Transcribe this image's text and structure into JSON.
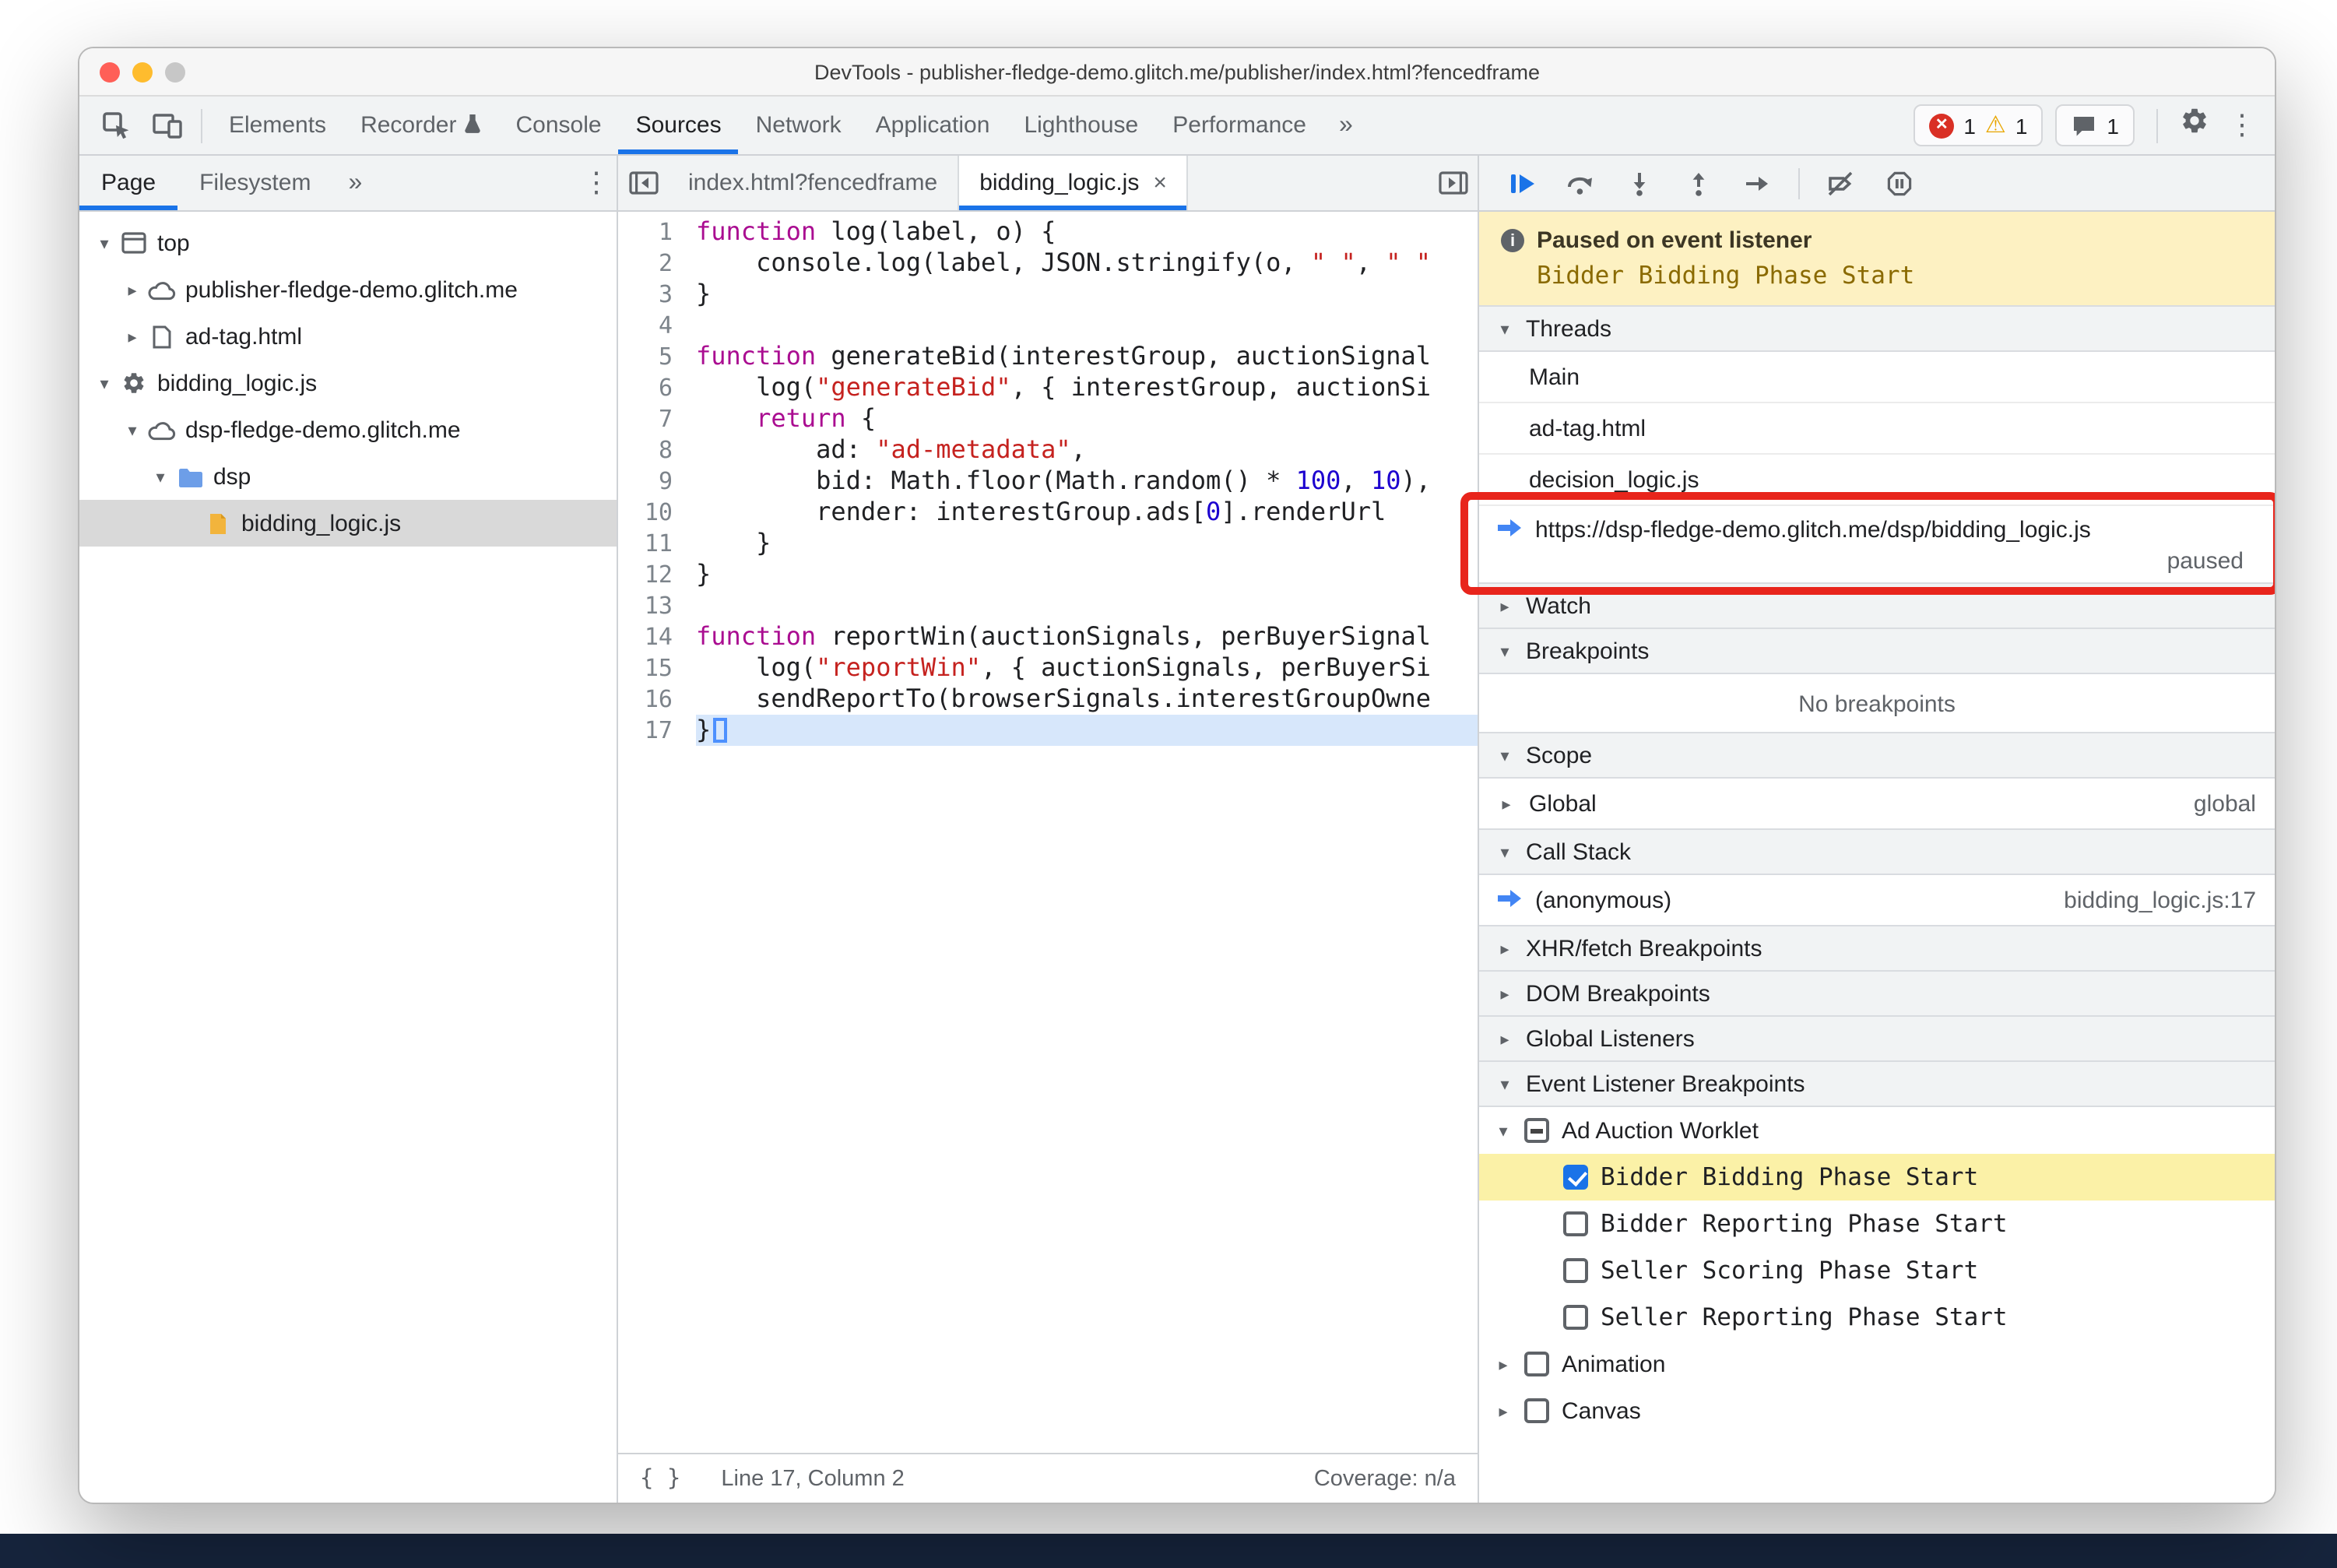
{
  "window": {
    "title": "DevTools - publisher-fledge-demo.glitch.me/publisher/index.html?fencedframe"
  },
  "toolbar": {
    "tabs": [
      {
        "label": "Elements"
      },
      {
        "label": "Recorder",
        "icon": "experiment-icon"
      },
      {
        "label": "Console"
      },
      {
        "label": "Sources",
        "active": true
      },
      {
        "label": "Network"
      },
      {
        "label": "Application"
      },
      {
        "label": "Lighthouse"
      },
      {
        "label": "Performance"
      }
    ],
    "more_label": "»",
    "errors": "1",
    "warnings": "1",
    "issues": "1"
  },
  "navigator": {
    "tabs": [
      {
        "label": "Page",
        "active": true
      },
      {
        "label": "Filesystem"
      }
    ],
    "more_label": "»",
    "tree": [
      {
        "label": "top",
        "icon": "frame",
        "state": "expanded",
        "indent": 0
      },
      {
        "label": "publisher-fledge-demo.glitch.me",
        "icon": "cloud",
        "state": "collapsed",
        "indent": 1
      },
      {
        "label": "ad-tag.html",
        "icon": "doc",
        "state": "collapsed",
        "indent": 1
      },
      {
        "label": "bidding_logic.js",
        "icon": "gear",
        "state": "expanded",
        "indent": 0
      },
      {
        "label": "dsp-fledge-demo.glitch.me",
        "icon": "cloud",
        "state": "expanded",
        "indent": 1
      },
      {
        "label": "dsp",
        "icon": "folder",
        "state": "expanded",
        "indent": 2
      },
      {
        "label": "bidding_logic.js",
        "icon": "file",
        "state": "leaf",
        "indent": 3,
        "selected": true
      }
    ]
  },
  "editor": {
    "tabs": [
      {
        "label": "index.html?fencedframe"
      },
      {
        "label": "bidding_logic.js",
        "active": true
      }
    ],
    "exec_line": 17,
    "lines": [
      {
        "n": 1,
        "seg": [
          [
            "k",
            "function"
          ],
          [
            "p",
            " log(label, o) {"
          ]
        ]
      },
      {
        "n": 2,
        "seg": [
          [
            "p",
            "    console.log(label, JSON.stringify(o, "
          ],
          [
            "s",
            "\" \""
          ],
          [
            "p",
            ", "
          ],
          [
            "s",
            "\" \""
          ]
        ]
      },
      {
        "n": 3,
        "seg": [
          [
            "p",
            "}"
          ]
        ]
      },
      {
        "n": 4,
        "seg": []
      },
      {
        "n": 5,
        "seg": [
          [
            "k",
            "function"
          ],
          [
            "p",
            " generateBid(interestGroup, auctionSignal"
          ]
        ]
      },
      {
        "n": 6,
        "seg": [
          [
            "p",
            "    log("
          ],
          [
            "s",
            "\"generateBid\""
          ],
          [
            "p",
            ", { interestGroup, auctionSi"
          ]
        ]
      },
      {
        "n": 7,
        "seg": [
          [
            "p",
            "    "
          ],
          [
            "k",
            "return"
          ],
          [
            "p",
            " {"
          ]
        ]
      },
      {
        "n": 8,
        "seg": [
          [
            "p",
            "        ad: "
          ],
          [
            "s",
            "\"ad-metadata\""
          ],
          [
            "p",
            ","
          ]
        ]
      },
      {
        "n": 9,
        "seg": [
          [
            "p",
            "        bid: Math.floor(Math.random() * "
          ],
          [
            "num",
            "100"
          ],
          [
            "p",
            ", "
          ],
          [
            "num",
            "10"
          ],
          [
            "p",
            "),"
          ]
        ]
      },
      {
        "n": 10,
        "seg": [
          [
            "p",
            "        render: interestGroup.ads["
          ],
          [
            "num",
            "0"
          ],
          [
            "p",
            "].renderUrl"
          ]
        ]
      },
      {
        "n": 11,
        "seg": [
          [
            "p",
            "    }"
          ]
        ]
      },
      {
        "n": 12,
        "seg": [
          [
            "p",
            "}"
          ]
        ]
      },
      {
        "n": 13,
        "seg": []
      },
      {
        "n": 14,
        "seg": [
          [
            "k",
            "function"
          ],
          [
            "p",
            " reportWin(auctionSignals, perBuyerSignal"
          ]
        ]
      },
      {
        "n": 15,
        "seg": [
          [
            "p",
            "    log("
          ],
          [
            "s",
            "\"reportWin\""
          ],
          [
            "p",
            ", { auctionSignals, perBuyerSi"
          ]
        ]
      },
      {
        "n": 16,
        "seg": [
          [
            "p",
            "    sendReportTo(browserSignals.interestGroupOwne"
          ]
        ]
      },
      {
        "n": 17,
        "seg": [
          [
            "p",
            "}"
          ]
        ]
      }
    ],
    "status": {
      "format_icon": "{ }",
      "line_col": "Line 17, Column 2",
      "coverage": "Coverage: n/a"
    }
  },
  "debugger": {
    "banner": {
      "title": "Paused on event listener",
      "detail": "Bidder Bidding Phase Start"
    },
    "threads": {
      "label": "Threads",
      "items": [
        {
          "label": "Main"
        },
        {
          "label": "ad-tag.html"
        },
        {
          "label": "decision_logic.js"
        },
        {
          "label": "https://dsp-fledge-demo.glitch.me/dsp/bidding_logic.js",
          "status": "paused",
          "current": true,
          "annotated": true
        }
      ]
    },
    "watch": {
      "label": "Watch"
    },
    "breakpoints": {
      "label": "Breakpoints",
      "empty_text": "No breakpoints"
    },
    "scope": {
      "label": "Scope",
      "rows": [
        {
          "label": "Global",
          "right": "global"
        }
      ]
    },
    "call_stack": {
      "label": "Call Stack",
      "rows": [
        {
          "label": "(anonymous)",
          "right": "bidding_logic.js:17",
          "current": true
        }
      ]
    },
    "xhr": {
      "label": "XHR/fetch Breakpoints"
    },
    "dom": {
      "label": "DOM Breakpoints"
    },
    "global_listeners": {
      "label": "Global Listeners"
    },
    "event_listener_breakpoints": {
      "label": "Event Listener Breakpoints",
      "groups": [
        {
          "label": "Ad Auction Worklet",
          "checkbox": "indeterminate",
          "state": "expanded",
          "children": [
            {
              "label": "Bidder Bidding Phase Start",
              "checked": true,
              "highlighted": true
            },
            {
              "label": "Bidder Reporting Phase Start",
              "checked": false
            },
            {
              "label": "Seller Scoring Phase Start",
              "checked": false
            },
            {
              "label": "Seller Reporting Phase Start",
              "checked": false
            }
          ]
        },
        {
          "label": "Animation",
          "checkbox": "unchecked",
          "state": "collapsed",
          "children": []
        },
        {
          "label": "Canvas",
          "checkbox": "unchecked",
          "state": "collapsed",
          "children": []
        }
      ]
    }
  },
  "colors": {
    "accent": "#1a73e8",
    "annotation_red": "#e8251c",
    "paused_banner_bg": "#fdf1c2",
    "selection_yellow": "#fbf1a7"
  }
}
